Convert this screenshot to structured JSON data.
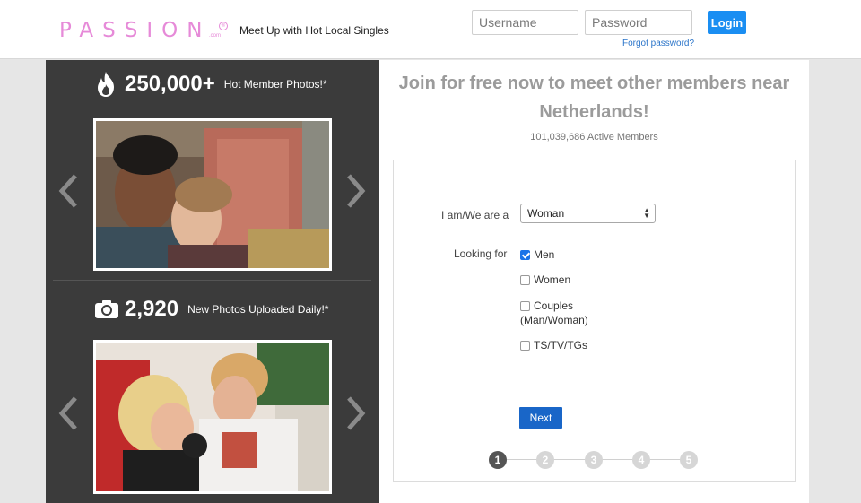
{
  "header": {
    "logo_text": "PASSION",
    "logo_suffix": ".com",
    "tagline": "Meet Up with Hot Local Singles",
    "username_placeholder": "Username",
    "password_placeholder": "Password",
    "login_label": "Login",
    "forgot_label": "Forgot password?"
  },
  "left_panel": {
    "stat1": {
      "number": "250,000+",
      "text": "Hot Member Photos!*",
      "icon": "fire-icon"
    },
    "stat2": {
      "number": "2,920",
      "text": "New Photos Uploaded Daily!*",
      "icon": "camera-icon"
    }
  },
  "signup": {
    "headline": "Join for free now to meet other members near Netherlands!",
    "active_members": "101,039,686 Active Members",
    "iam_label": "I am/We are a",
    "iam_value": "Woman",
    "looking_label": "Looking for",
    "options": [
      {
        "label": "Men",
        "checked": true
      },
      {
        "label": "Women",
        "checked": false
      },
      {
        "label": "Couples",
        "checked": false
      },
      {
        "label": "TS/TV/TGs",
        "checked": false
      }
    ],
    "couples_sub": "(Man/Woman)",
    "next_label": "Next",
    "steps": [
      "1",
      "2",
      "3",
      "4",
      "5"
    ],
    "active_step": 1
  },
  "colors": {
    "brand_pink": "#e68ad8",
    "login_blue": "#1a8ef2",
    "next_blue": "#1966c8",
    "panel_dark": "#3b3b3b"
  }
}
